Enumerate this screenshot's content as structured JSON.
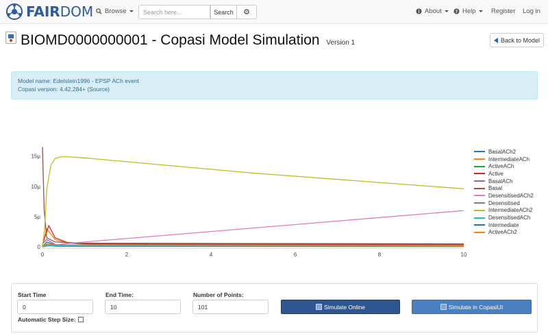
{
  "navbar": {
    "brand_fair": "FAIR",
    "brand_dom": "DOM",
    "browse_label": "Browse",
    "search_placeholder": "Search here...",
    "search_button": "Search",
    "about_label": "About",
    "help_label": "Help",
    "register_label": "Register",
    "login_label": "Log in"
  },
  "page": {
    "title": "BIOMD0000000001 - Copasi Model Simulation",
    "version": "Version 1",
    "back_button": "Back to Model"
  },
  "info": {
    "model_name": "Model name: Edelstein1996 - EPSP ACh event",
    "copasi_version": "Copasi version: 4.42.284+ (Source)"
  },
  "chart_data": {
    "type": "line",
    "xlim": [
      0,
      10
    ],
    "ylim": [
      0,
      17
    ],
    "x_ticks": [
      0,
      2,
      4,
      6,
      8,
      10
    ],
    "y_ticks": [
      {
        "value": 0,
        "label": "0"
      },
      {
        "value": 5,
        "label": "5μ"
      },
      {
        "value": 10,
        "label": "10μ"
      },
      {
        "value": 15,
        "label": "15μ"
      }
    ],
    "grid": false,
    "legend_position": "right",
    "series": [
      {
        "name": "BasalACh2",
        "color": "#1f77b4",
        "points": [
          [
            0,
            0.1
          ],
          [
            0.1,
            0.3
          ],
          [
            0.3,
            0.1
          ],
          [
            1,
            0.1
          ],
          [
            10,
            0.1
          ]
        ]
      },
      {
        "name": "IntermediateACh",
        "color": "#ff7f0e",
        "points": [
          [
            0,
            0.2
          ],
          [
            0.1,
            3.0
          ],
          [
            0.3,
            1.2
          ],
          [
            0.6,
            0.6
          ],
          [
            1,
            0.45
          ],
          [
            10,
            0.3
          ]
        ]
      },
      {
        "name": "ActiveACh",
        "color": "#2ca02c",
        "points": [
          [
            0,
            0
          ],
          [
            0.1,
            0.2
          ],
          [
            0.4,
            0.1
          ],
          [
            10,
            0.05
          ]
        ]
      },
      {
        "name": "Active",
        "color": "#d62728",
        "points": [
          [
            0,
            0.3
          ],
          [
            0.05,
            1.5
          ],
          [
            0.15,
            3.5
          ],
          [
            0.3,
            1.5
          ],
          [
            0.6,
            0.7
          ],
          [
            1,
            0.5
          ],
          [
            10,
            0.4
          ]
        ]
      },
      {
        "name": "BasalACh",
        "color": "#9467bd",
        "points": [
          [
            0,
            0.5
          ],
          [
            0.1,
            1.2
          ],
          [
            0.3,
            0.4
          ],
          [
            1,
            0.2
          ],
          [
            10,
            0.1
          ]
        ]
      },
      {
        "name": "Basal",
        "color": "#8c564b",
        "points": [
          [
            0,
            16.5
          ],
          [
            0.04,
            6
          ],
          [
            0.1,
            1.5
          ],
          [
            0.3,
            0.8
          ],
          [
            1,
            0.6
          ],
          [
            10,
            0.5
          ]
        ]
      },
      {
        "name": "DesensitisedACh2",
        "color": "#e377c2",
        "points": [
          [
            0,
            0
          ],
          [
            0.5,
            0.5
          ],
          [
            1,
            0.8
          ],
          [
            10,
            6.0
          ]
        ]
      },
      {
        "name": "Desensitised",
        "color": "#7f7f7f",
        "points": [
          [
            0,
            0
          ],
          [
            0.1,
            0.3
          ],
          [
            1,
            0.3
          ],
          [
            10,
            0.3
          ]
        ]
      },
      {
        "name": "IntermediateACh2",
        "color": "#bcbd22",
        "points": [
          [
            0,
            0
          ],
          [
            0.05,
            3
          ],
          [
            0.1,
            9.5
          ],
          [
            0.2,
            13.5
          ],
          [
            0.3,
            14.6
          ],
          [
            0.45,
            14.9
          ],
          [
            0.6,
            14.9
          ],
          [
            1,
            14.7
          ],
          [
            5,
            12.2
          ],
          [
            10,
            9.6
          ]
        ]
      },
      {
        "name": "DesensitisedACh",
        "color": "#17becf",
        "points": [
          [
            0,
            0
          ],
          [
            0.1,
            0.2
          ],
          [
            10,
            0.1
          ]
        ]
      },
      {
        "name": "Intermediate",
        "color": "#1f77b4",
        "points": [
          [
            0,
            0
          ],
          [
            0.1,
            0.8
          ],
          [
            0.3,
            0.3
          ],
          [
            10,
            0.2
          ]
        ]
      },
      {
        "name": "ActiveACh2",
        "color": "#ff7f0e",
        "points": [
          [
            0,
            0
          ],
          [
            0.1,
            0.5
          ],
          [
            0.3,
            0.3
          ],
          [
            10,
            0.2
          ]
        ]
      }
    ]
  },
  "form": {
    "start_time_label": "Start Time",
    "start_time_value": "0",
    "end_time_label": "End Time:",
    "end_time_value": "10",
    "points_label": "Number of Points:",
    "points_value": "101",
    "auto_step_label": "Automatic Step Size:",
    "simulate_online": "Simulate Online",
    "simulate_copasi": "Simulate in CopasiUI"
  }
}
